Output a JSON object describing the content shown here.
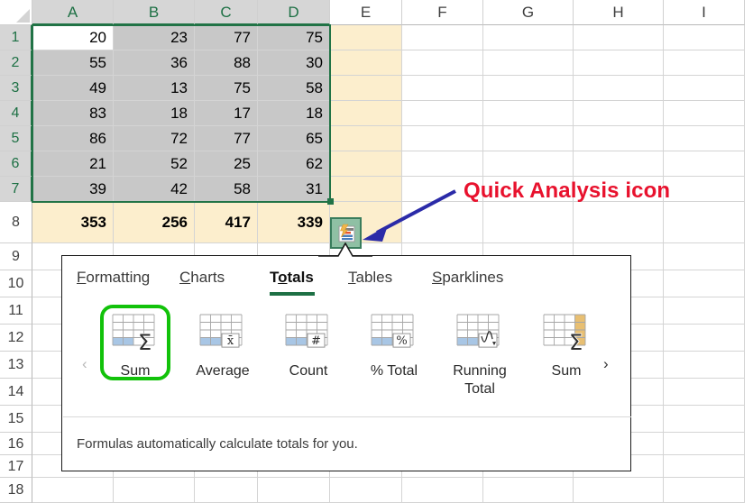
{
  "spreadsheet": {
    "column_headers": [
      "A",
      "B",
      "C",
      "D",
      "E",
      "F",
      "G",
      "H",
      "I"
    ],
    "selected_columns": [
      "A",
      "B",
      "C",
      "D"
    ],
    "row_headers": [
      "1",
      "2",
      "3",
      "4",
      "5",
      "6",
      "7",
      "8",
      "9",
      "10",
      "11",
      "12",
      "13",
      "14",
      "15",
      "16",
      "17",
      "18"
    ],
    "selected_rows": [
      "1",
      "2",
      "3",
      "4",
      "5",
      "6",
      "7"
    ],
    "active_cell": "A1",
    "selection_range": "A1:D7",
    "data_rows": [
      [
        "20",
        "23",
        "77",
        "75"
      ],
      [
        "55",
        "36",
        "88",
        "30"
      ],
      [
        "49",
        "13",
        "75",
        "58"
      ],
      [
        "83",
        "18",
        "17",
        "18"
      ],
      [
        "86",
        "72",
        "77",
        "65"
      ],
      [
        "21",
        "52",
        "25",
        "62"
      ],
      [
        "39",
        "42",
        "58",
        "31"
      ]
    ],
    "totals_row": [
      "353",
      "256",
      "417",
      "339"
    ],
    "totals_row_number": "8",
    "colors": {
      "selection_border": "#217346",
      "selected_fill": "#c8c8c8",
      "total_fill": "#fceecd",
      "header_selected_text": "#1d7044"
    }
  },
  "quick_analysis_button": {
    "name": "quick-analysis-icon",
    "tooltip_target_cell": "E8"
  },
  "annotation": {
    "text": "Quick Analysis icon",
    "text_color": "#e8112d",
    "arrow_color": "#2b2ba8",
    "cursor_color": "#e8112d"
  },
  "quick_analysis_panel": {
    "tabs": [
      {
        "label": "Formatting",
        "accel_index": 0,
        "active": false
      },
      {
        "label": "Charts",
        "accel_index": 0,
        "active": false
      },
      {
        "label": "Totals",
        "accel_index": 1,
        "active": true
      },
      {
        "label": "Tables",
        "accel_index": 0,
        "active": false
      },
      {
        "label": "Sparklines",
        "accel_index": 0,
        "active": false
      }
    ],
    "items": [
      {
        "label": "Sum",
        "icon": "sum-row-icon",
        "glyph": "Σ",
        "highlight": "row",
        "selected": true
      },
      {
        "label": "Average",
        "icon": "average-icon",
        "glyph": "x̄",
        "highlight": "row",
        "selected": false
      },
      {
        "label": "Count",
        "icon": "count-icon",
        "glyph": "#",
        "highlight": "row",
        "selected": false
      },
      {
        "label": "% Total",
        "icon": "percent-total-icon",
        "glyph": "%",
        "highlight": "row",
        "selected": false
      },
      {
        "label": "Running Total",
        "icon": "running-total-icon",
        "glyph": "wave",
        "highlight": "row",
        "selected": false
      },
      {
        "label": "Sum",
        "icon": "sum-column-icon",
        "glyph": "Σ",
        "highlight": "column",
        "selected": false
      }
    ],
    "prev_chevron": "‹",
    "next_chevron": "›",
    "prev_enabled": false,
    "next_enabled": true,
    "footer_text": "Formulas automatically calculate totals for you.",
    "colors": {
      "active_tab_underline": "#1d7044",
      "selection_ring": "#12c20a",
      "row_highlight": "#a8c6e5",
      "column_highlight": "#e8bf72"
    }
  }
}
